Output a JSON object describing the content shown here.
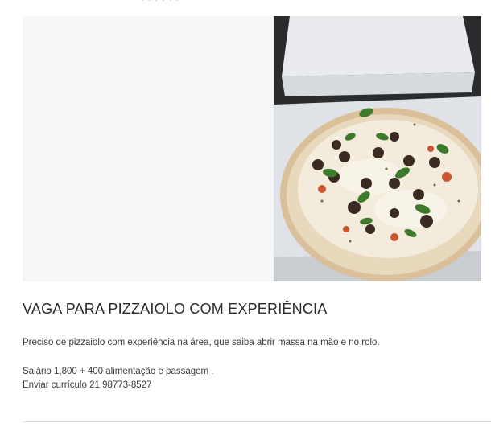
{
  "post": {
    "image_alt": "Pizza em caixa",
    "title": "VAGA PARA PIZZAIOLO COM EXPERIÊNCIA",
    "paragraph_1": "Preciso de pizzaiolo com experiência na área, que saiba abrir massa na mão e no rolo.",
    "paragraph_2": "Salário 1,800 + 400 alimentação e passagem .",
    "paragraph_3": "Enviar currículo 21 98773-8527"
  }
}
